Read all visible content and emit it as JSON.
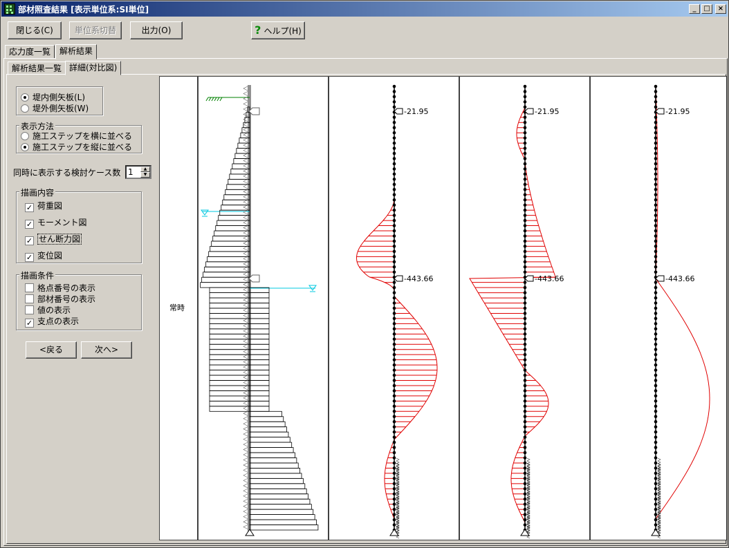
{
  "window": {
    "title": "部材照査結果 [表示単位系:SI単位]",
    "controls": {
      "minimize": "_",
      "maximize": "□",
      "close": "×"
    }
  },
  "toolbar": {
    "close_label": "閉じる(C)",
    "unit_toggle_label": "単位系切替",
    "output_label": "出力(O)",
    "help_label": "ヘルプ(H)",
    "help_icon": "question-icon"
  },
  "tabs_top": [
    {
      "label": "応力度一覧",
      "active": false
    },
    {
      "label": "解析結果",
      "active": true
    }
  ],
  "tabs_sub": [
    {
      "label": "解析結果一覧",
      "active": false
    },
    {
      "label": "詳細(対比図)",
      "active": true
    }
  ],
  "side_panel": {
    "wall_side": {
      "options": [
        {
          "label": "堤内側矢板(L)",
          "selected": true
        },
        {
          "label": "堤外側矢板(W)",
          "selected": false
        }
      ]
    },
    "display_method": {
      "title": "表示方法",
      "options": [
        {
          "label": "施工ステップを横に並べる",
          "selected": false
        },
        {
          "label": "施工ステップを縦に並べる",
          "selected": true
        }
      ]
    },
    "case_count": {
      "label": "同時に表示する検討ケース数",
      "value": "1"
    },
    "draw_content": {
      "title": "描画内容",
      "items": [
        {
          "label": "荷重図",
          "checked": true
        },
        {
          "label": "モーメント図",
          "checked": true
        },
        {
          "label": "せん断力図",
          "checked": true
        },
        {
          "label": "変位図",
          "checked": true
        }
      ]
    },
    "draw_conditions": {
      "title": "描画条件",
      "items": [
        {
          "label": "格点番号の表示",
          "checked": false
        },
        {
          "label": "部材番号の表示",
          "checked": false
        },
        {
          "label": "値の表示",
          "checked": false
        },
        {
          "label": "支点の表示",
          "checked": true
        }
      ]
    },
    "prev_label": "<戻る",
    "next_label": "次へ>"
  },
  "chart_data": {
    "type": "line",
    "case_label": "常時",
    "panels": [
      "荷重図",
      "モーメント図",
      "せん断力図",
      "変位図"
    ],
    "support_levels": [
      {
        "label": "-21.95"
      },
      {
        "label": "-443.66"
      }
    ],
    "colors": {
      "curve": "#e00000",
      "node": "#000000",
      "water": "#00c8e0",
      "ground": "#008000"
    }
  }
}
